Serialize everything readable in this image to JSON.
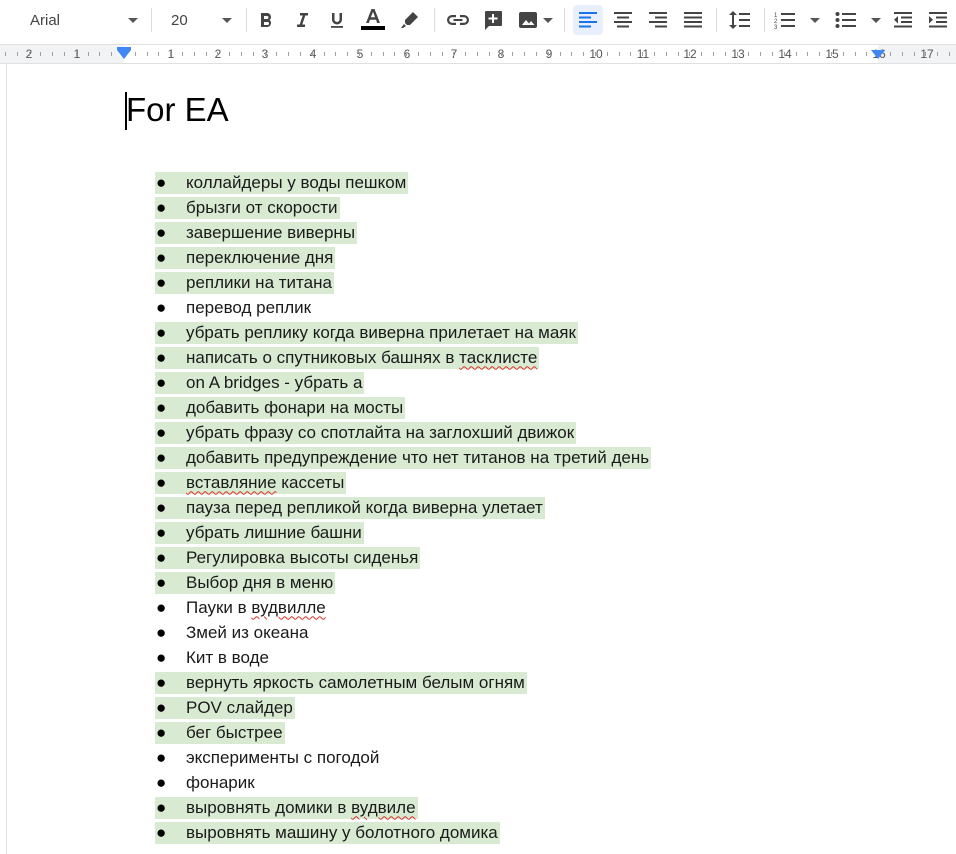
{
  "toolbar": {
    "font": "Arial",
    "font_size": "20",
    "colors": {
      "text_color_bar": "#000000",
      "active_button_bg": "#e8f0fe",
      "accent": "#1a73e8"
    },
    "buttons": [
      "bold-icon",
      "italic-icon",
      "underline-icon",
      "text-color-icon",
      "highlight-icon",
      "link-icon",
      "add-comment-icon",
      "insert-image-icon",
      "align-left-icon",
      "align-center-icon",
      "align-right-icon",
      "justify-icon",
      "line-spacing-icon",
      "numbered-list-icon",
      "bulleted-list-icon",
      "decrease-indent-icon",
      "increase-indent-icon"
    ],
    "active_alignment": "left"
  },
  "ruler": {
    "labels": [
      "2",
      "1",
      "1",
      "2",
      "3",
      "4",
      "5",
      "6",
      "7",
      "8",
      "9",
      "10",
      "11",
      "12",
      "13",
      "14",
      "15",
      "16",
      "17"
    ]
  },
  "document": {
    "title": "For EA",
    "highlight_color": "#d9ead3",
    "items": [
      {
        "text": "коллайдеры у воды пешком",
        "highlighted": true
      },
      {
        "text": "брызги от скорости",
        "highlighted": true
      },
      {
        "text": "завершение виверны",
        "highlighted": true
      },
      {
        "text": "переключение дня",
        "highlighted": true
      },
      {
        "text": "реплики на титана",
        "highlighted": true
      },
      {
        "text": "перевод реплик",
        "highlighted": false
      },
      {
        "text": "убрать реплику когда виверна прилетает на маяк",
        "highlighted": true
      },
      {
        "text": "написать о спутниковых башнях в ",
        "spell": "тасклисте",
        "highlighted": true
      },
      {
        "text": "on A bridges - убрать а",
        "highlighted": true
      },
      {
        "text": "добавить фонари на мосты",
        "highlighted": true
      },
      {
        "text": "убрать фразу со спотлайта на заглохший движок",
        "highlighted": true
      },
      {
        "text": "добавить предупреждение что нет титанов на третий день",
        "highlighted": true
      },
      {
        "text": "",
        "spell": "вставляние",
        "after": " кассеты",
        "highlighted": true
      },
      {
        "text": "пауза перед репликой когда виверна улетает",
        "highlighted": true
      },
      {
        "text": "убрать лишние башни",
        "highlighted": true
      },
      {
        "text": "Регулировка высоты сиденья",
        "highlighted": true
      },
      {
        "text": "Выбор дня в меню",
        "highlighted": true
      },
      {
        "text": "Пауки в ",
        "spell": "вудвилле",
        "highlighted": false
      },
      {
        "text": "Змей из океана",
        "highlighted": false
      },
      {
        "text": "Кит в воде",
        "highlighted": false
      },
      {
        "text": "вернуть яркость самолетным белым огням",
        "highlighted": true
      },
      {
        "text": "POV слайдер",
        "highlighted": true
      },
      {
        "text": "бег быстрее",
        "highlighted": true
      },
      {
        "text": "эксперименты с погодой",
        "highlighted": false
      },
      {
        "text": "фонарик",
        "highlighted": false
      },
      {
        "text": "выровнять домики в ",
        "spell": "вудвиле",
        "highlighted": true
      },
      {
        "text": "выровнять машину у болотного домика",
        "highlighted": true
      }
    ]
  }
}
